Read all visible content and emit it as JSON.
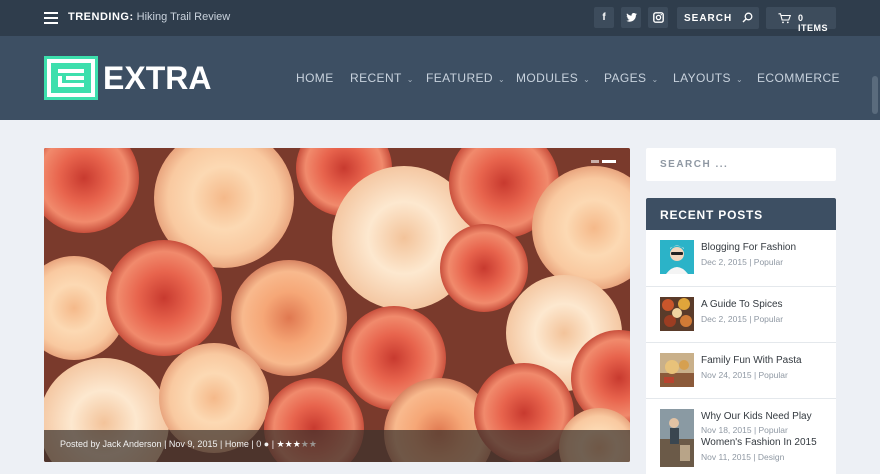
{
  "topbar": {
    "trending_label": "TRENDING:",
    "trending_text": "Hiking Trail Review",
    "search_label": "SEARCH",
    "cart_label": "0 ITEMS",
    "social": [
      "f",
      "t",
      "ig"
    ]
  },
  "header": {
    "logo_text": "EXTRA",
    "nav": [
      "HOME",
      "RECENT",
      "FEATURED",
      "MODULES",
      "PAGES",
      "LAYOUTS",
      "ECOMMERCE"
    ]
  },
  "featured": {
    "posted_by": "Posted by Jack Anderson",
    "date": "Nov 9, 2015",
    "category": "Home",
    "comments": "0",
    "rating": 3,
    "rating_max": 5
  },
  "sidebar": {
    "search_placeholder": "SEARCH ...",
    "widget_title": "RECENT POSTS",
    "posts": [
      {
        "title": "Blogging For Fashion",
        "date": "Dec 2, 2015",
        "category": "Popular"
      },
      {
        "title": "A Guide To Spices",
        "date": "Dec 2, 2015",
        "category": "Popular"
      },
      {
        "title": "Family Fun With Pasta",
        "date": "Nov 24, 2015",
        "category": "Popular"
      },
      {
        "title": "Why Our Kids Need Play",
        "date": "Nov 18, 2015",
        "category": "Popular"
      },
      {
        "title": "Women's Fashion In 2015",
        "date": "Nov 11, 2015",
        "category": "Design"
      }
    ]
  },
  "colors": {
    "topbar": "#2f3d4c",
    "header": "#3d4f63",
    "accent": "#3ddfad",
    "page_bg": "#edf0f5"
  }
}
